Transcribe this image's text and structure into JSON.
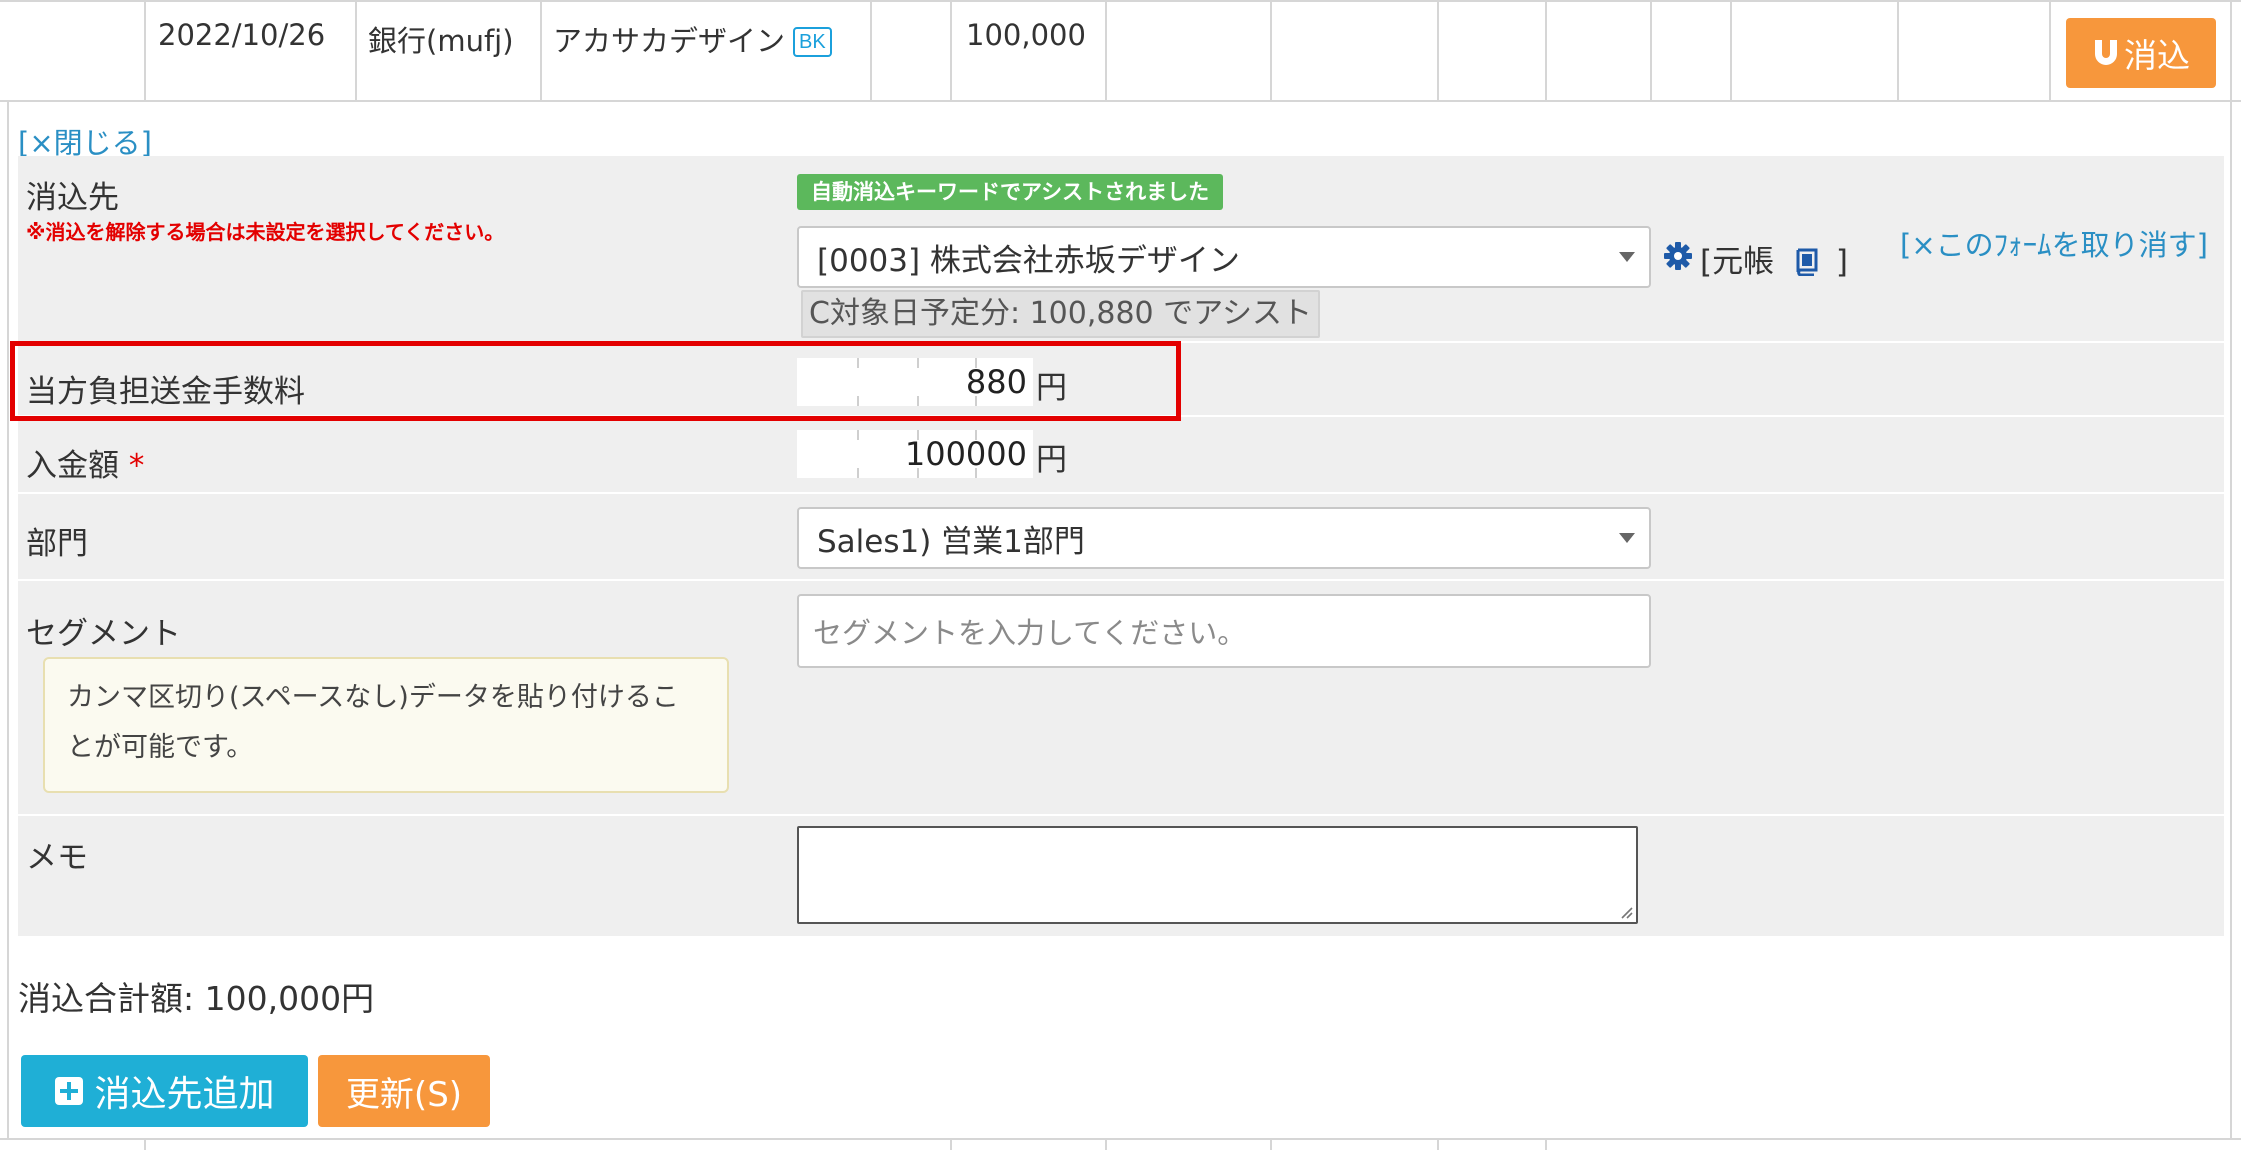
{
  "top_row": {
    "date": "2022/10/26",
    "account": "銀行(mufj)",
    "payer": "アカサカデザイン",
    "payer_badge": "BK",
    "amount": "100,000",
    "reconcile_button": "消込"
  },
  "form": {
    "close_link": "[×閉じる]",
    "target": {
      "label": "消込先",
      "warning": "※消込を解除する場合は未設定を選択してください。",
      "assist_badge": "自動消込キーワードでアシストされました",
      "selected": "[0003] 株式会社赤坂デザイン",
      "ledger_open": "[元帳",
      "ledger_close": "]",
      "cancel_form_link": "[×このﾌｫｰﾑを取り消す]",
      "assist_note": "C対象日予定分: 100,880 でアシスト"
    },
    "fee": {
      "label": "当方負担送金手数料",
      "value": "880",
      "unit": "円"
    },
    "deposit": {
      "label": "入金額",
      "required_mark": "*",
      "value": "100000",
      "unit": "円"
    },
    "department": {
      "label": "部門",
      "selected": "Sales1) 営業1部門"
    },
    "segment": {
      "label": "セグメント",
      "placeholder": "セグメントを入力してください。",
      "hint": "カンマ区切り(スペースなし)データを貼り付けることが可能です。"
    },
    "memo": {
      "label": "メモ",
      "value": ""
    }
  },
  "total": {
    "label": "消込合計額: 100,000円"
  },
  "buttons": {
    "add_target": "消込先追加",
    "update": "更新(S)"
  },
  "colors": {
    "orange_button": "#f7973c",
    "blue_button": "#1fafd6",
    "link": "#2a8fc4",
    "highlight": "#e30000",
    "assist_green": "#5cb85c",
    "required": "#e30000"
  }
}
